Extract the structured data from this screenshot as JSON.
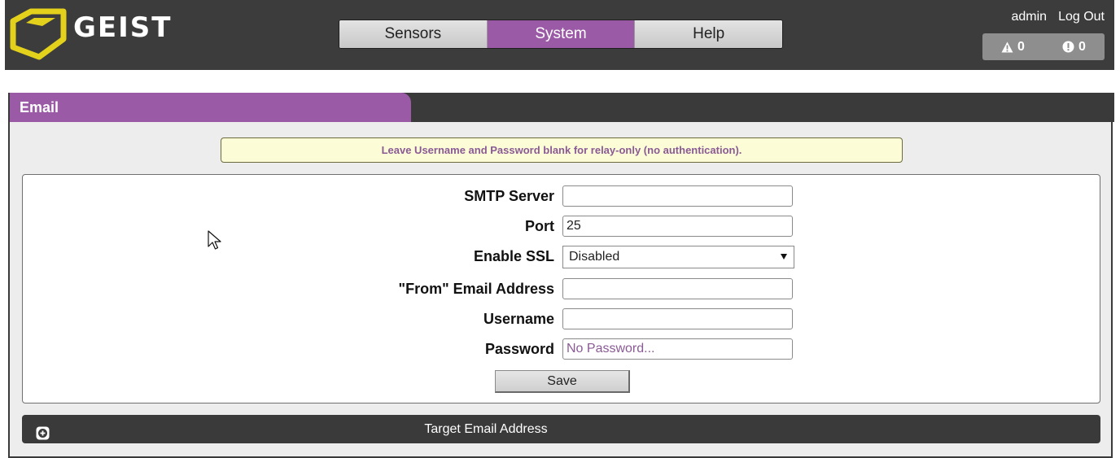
{
  "header": {
    "logo_text": "GEIST",
    "nav": [
      {
        "label": "Sensors",
        "active": false
      },
      {
        "label": "System",
        "active": true
      },
      {
        "label": "Help",
        "active": false
      }
    ],
    "user": {
      "name": "admin",
      "logout": "Log Out"
    },
    "alarms": {
      "warnings": "0",
      "alarms": "0"
    }
  },
  "panel": {
    "title": "Email",
    "notice": "Leave Username and Password blank for relay-only (no authentication).",
    "fields": {
      "smtp_server": {
        "label": "SMTP Server",
        "value": ""
      },
      "port": {
        "label": "Port",
        "value": "25"
      },
      "enable_ssl": {
        "label": "Enable SSL",
        "value": "Disabled"
      },
      "from_email": {
        "label": "\"From\" Email Address",
        "value": ""
      },
      "username": {
        "label": "Username",
        "value": ""
      },
      "password": {
        "label": "Password",
        "value": "",
        "placeholder": "No Password..."
      }
    },
    "save_label": "Save",
    "target_section": "Target Email Address"
  },
  "colors": {
    "accent": "#9a5aa6",
    "header_bg": "#3c3c3c",
    "logo_yellow": "#e3d11c",
    "notice_bg": "#fcfcd7"
  },
  "icons": {
    "warning": "warning-triangle-icon",
    "alarm": "exclamation-circle-icon",
    "expand": "plus-circle-icon"
  }
}
